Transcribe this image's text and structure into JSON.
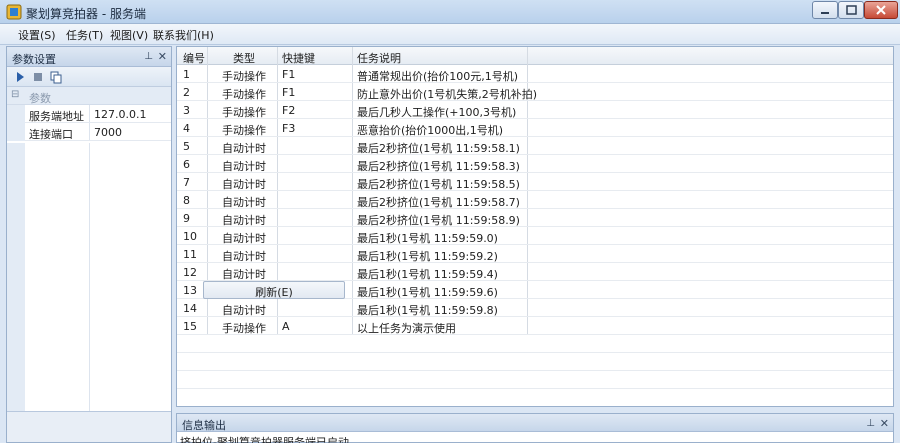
{
  "window": {
    "title": "聚划算竞拍器 - 服务端"
  },
  "menu": [
    {
      "label": "设置(S)"
    },
    {
      "label": "任务(T)"
    },
    {
      "label": "视图(V)"
    },
    {
      "label": "联系我们(H)"
    }
  ],
  "params_panel": {
    "title": "参数设置",
    "category": "参数",
    "properties": [
      {
        "name": "服务端地址",
        "value": "127.0.0.1"
      },
      {
        "name": "连接端口",
        "value": "7000"
      }
    ]
  },
  "grid": {
    "headers": [
      "编号",
      "类型",
      "快捷键",
      "任务说明"
    ],
    "rows": [
      {
        "num": "1",
        "type": "手动操作",
        "key": "F1",
        "desc": "普通常规出价(抬价100元,1号机)"
      },
      {
        "num": "2",
        "type": "手动操作",
        "key": "F1",
        "desc": "防止意外出价(1号机失策,2号机补拍)"
      },
      {
        "num": "3",
        "type": "手动操作",
        "key": "F2",
        "desc": "最后几秒人工操作(+100,3号机)"
      },
      {
        "num": "4",
        "type": "手动操作",
        "key": "F3",
        "desc": "恶意抬价(抬价1000出,1号机)"
      },
      {
        "num": "5",
        "type": "自动计时",
        "key": "",
        "desc": "最后2秒挤位(1号机 11:59:58.1)"
      },
      {
        "num": "6",
        "type": "自动计时",
        "key": "",
        "desc": "最后2秒挤位(1号机 11:59:58.3)"
      },
      {
        "num": "7",
        "type": "自动计时",
        "key": "",
        "desc": "最后2秒挤位(1号机 11:59:58.5)"
      },
      {
        "num": "8",
        "type": "自动计时",
        "key": "",
        "desc": "最后2秒挤位(1号机 11:59:58.7)"
      },
      {
        "num": "9",
        "type": "自动计时",
        "key": "",
        "desc": "最后2秒挤位(1号机 11:59:58.9)"
      },
      {
        "num": "10",
        "type": "自动计时",
        "key": "",
        "desc": "最后1秒(1号机 11:59:59.0)"
      },
      {
        "num": "11",
        "type": "自动计时",
        "key": "",
        "desc": "最后1秒(1号机 11:59:59.2)"
      },
      {
        "num": "12",
        "type": "自动计时",
        "key": "",
        "desc": "最后1秒(1号机 11:59:59.4)"
      },
      {
        "num": "13",
        "type": "",
        "key": "",
        "desc": "最后1秒(1号机 11:59:59.6)"
      },
      {
        "num": "14",
        "type": "自动计时",
        "key": "",
        "desc": "最后1秒(1号机 11:59:59.8)"
      },
      {
        "num": "15",
        "type": "手动操作",
        "key": "A",
        "desc": "以上任务为演示使用"
      }
    ],
    "context_button": "刷新(E)"
  },
  "output_panel": {
    "title": "信息输出",
    "text": "挤拍位-聚划算竞拍器服务端已启动。"
  }
}
